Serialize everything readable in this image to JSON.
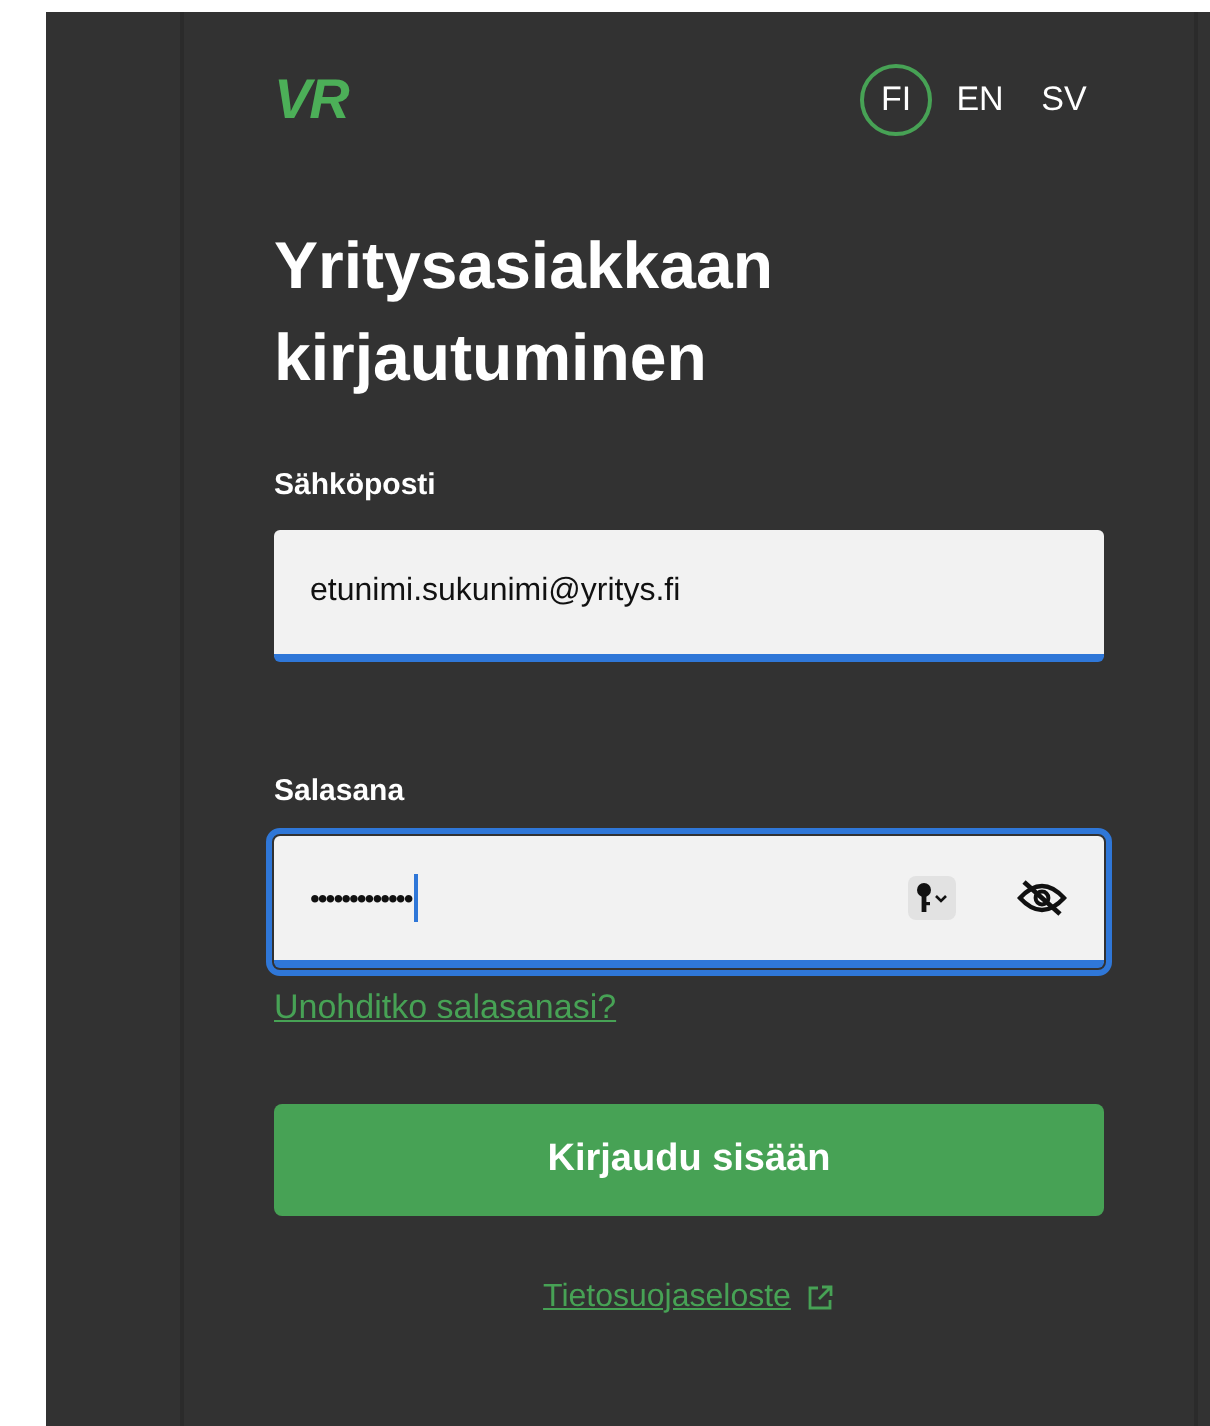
{
  "logo": {
    "text": "VR"
  },
  "languages": [
    {
      "label": "FI",
      "selected": true
    },
    {
      "label": "EN",
      "selected": false
    },
    {
      "label": "SV",
      "selected": false
    }
  ],
  "title": "Yritysasiakkaan kirjautuminen",
  "fields": [
    {
      "kind": "email",
      "label": "Sähköposti",
      "value": "etunimi.sukunimi@yritys.fi",
      "focused": false
    },
    {
      "kind": "password",
      "label": "Salasana",
      "value": "•••••••••••••",
      "focused": true
    }
  ],
  "forgot_link": "Unohditko salasanasi?",
  "submit_button": "Kirjaudu sisään",
  "privacy_link": "Tietosuojaseloste"
}
